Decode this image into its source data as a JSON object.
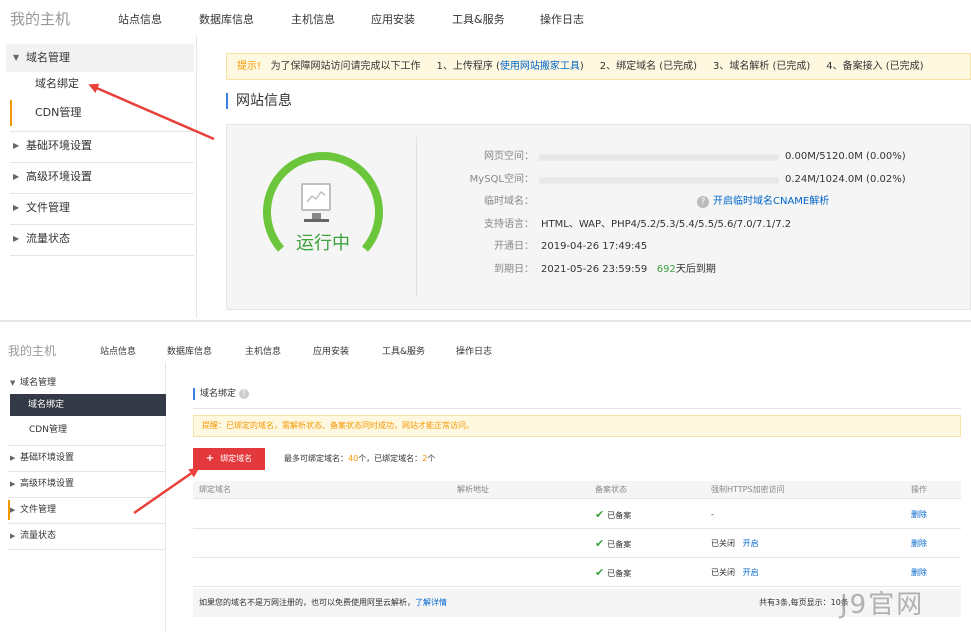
{
  "top": {
    "brand": "我的主机",
    "nav": [
      "站点信息",
      "数据库信息",
      "主机信息",
      "应用安装",
      "工具&服务",
      "操作日志"
    ],
    "sidebar": {
      "domain_group": "域名管理",
      "bind": "域名绑定",
      "cdn": "CDN管理",
      "base_env": "基础环境设置",
      "adv_env": "高级环境设置",
      "file": "文件管理",
      "traffic": "流量状态"
    },
    "notice": {
      "tip": "提示!",
      "text1": "为了保障网站访问请完成以下工作",
      "step1_prefix": "1、上传程序 (",
      "step1_link": "使用网站搬家工具",
      "step1_suffix": ")",
      "step2": "2、绑定域名 (已完成)",
      "step3": "3、域名解析 (已完成)",
      "step4": "4、备案接入 (已完成)"
    },
    "section_title": "网站信息",
    "status": "运行中",
    "info": {
      "web_space_label": "网页空间：",
      "web_space_value": "0.00M/5120.0M (0.00%)",
      "web_space_pct": 0,
      "mysql_label": "MySQL空间：",
      "mysql_value": "0.24M/1024.0M (0.02%)",
      "mysql_pct": 0.02,
      "tmp_domain_label": "临时域名：",
      "tmp_domain_link": "开启临时域名CNAME解析",
      "lang_label": "支持语言：",
      "lang_value": "HTML、WAP、PHP4/5.2/5.3/5.4/5.5/5.6/7.0/7.1/7.2",
      "open_label": "开通日：",
      "open_value": "2019-04-26 17:49:45",
      "expire_label": "到期日：",
      "expire_value": "2021-05-26 23:59:59",
      "expire_days": "692",
      "expire_suffix": "天后到期"
    }
  },
  "bottom": {
    "brand": "我的主机",
    "nav": [
      "站点信息",
      "数据库信息",
      "主机信息",
      "应用安装",
      "工具&服务",
      "操作日志"
    ],
    "sidebar": {
      "domain_group": "域名管理",
      "bind": "域名绑定",
      "cdn": "CDN管理",
      "base_env": "基础环境设置",
      "adv_env": "高级环境设置",
      "file": "文件管理",
      "traffic": "流量状态"
    },
    "section_title": "域名绑定",
    "notice": "提醒：已绑定的域名，需解析状态、备案状态同时成功，网站才能正常访问。",
    "bind_button": "绑定域名",
    "counts_prefix": "最多可绑定域名：",
    "max_count": "40",
    "counts_mid": "个，已绑定域名：",
    "bound_count": "2",
    "counts_suffix": "个",
    "table": {
      "headers": [
        "绑定域名",
        "解析地址",
        "备案状态",
        "强制HTTPS加密访问",
        "操作"
      ],
      "rows": [
        {
          "status": "已备案",
          "https": "-",
          "https_action": "",
          "op": "删除"
        },
        {
          "status": "已备案",
          "https": "已关闭",
          "https_action": "开启",
          "op": "删除"
        },
        {
          "status": "已备案",
          "https": "已关闭",
          "https_action": "开启",
          "op": "删除"
        }
      ],
      "footer_text": "如果您的域名不是万网注册的，也可以免费使用阿里云解析，",
      "footer_link": "了解详情",
      "footer_right": "共有3条,每页显示：10条"
    }
  },
  "watermark": "J9官网",
  "colors": {
    "accent_blue": "#3b7fdd",
    "running_green": "#3da33d",
    "notice_orange": "#f39800",
    "button_red": "#e4393c",
    "arrow_red": "#e8403a"
  }
}
